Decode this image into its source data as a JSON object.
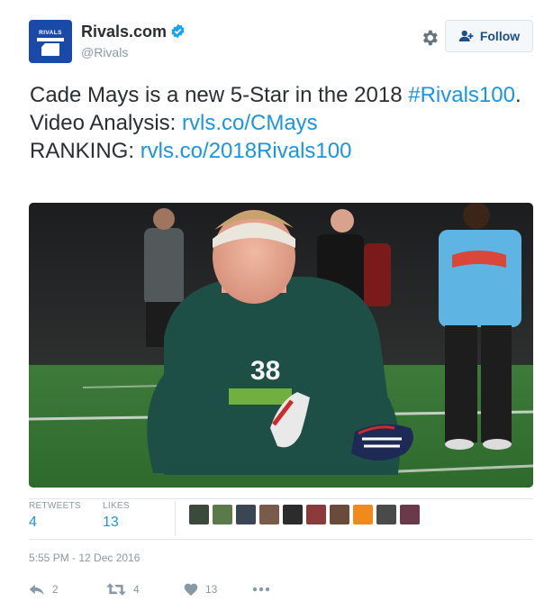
{
  "account": {
    "display_name": "Rivals.com",
    "handle": "@Rivals",
    "logo_text": "RIVALS",
    "brand_color": "#1a4aa8",
    "verified_color": "#1da1f2"
  },
  "header": {
    "follow_label": "Follow"
  },
  "tweet": {
    "line1_text": "Cade Mays is a new 5-Star in the 2018 ",
    "hashtag": "#Rivals100",
    "line1_end": ".",
    "video_label": "Video Analysis: ",
    "video_link": "rvls.co/CMays",
    "ranking_label": "RANKING: ",
    "ranking_link": "rvls.co/2018Rivals100",
    "link_color": "#1b95e0"
  },
  "photo": {
    "jersey_number": "38",
    "icon": "football-player-photo"
  },
  "stats": {
    "retweets_label": "RETWEETS",
    "retweets_count": "4",
    "likes_label": "LIKES",
    "likes_count": "13"
  },
  "likers": {
    "avatars": [
      "liker-1",
      "liker-2",
      "liker-3",
      "liker-4",
      "liker-5",
      "liker-6",
      "liker-7",
      "liker-8",
      "liker-9",
      "liker-10"
    ],
    "colors": [
      "#3b4a3a",
      "#5a7a4a",
      "#3a4652",
      "#7a5a4a",
      "#2c2c2c",
      "#8a3a3a",
      "#6a4a3a",
      "#f08a1c",
      "#4a4a4a",
      "#6a3a4a"
    ]
  },
  "timestamp": "5:55 PM - 12 Dec 2016",
  "actions": {
    "reply_count": "2",
    "retweet_count": "4",
    "like_count": "13"
  }
}
